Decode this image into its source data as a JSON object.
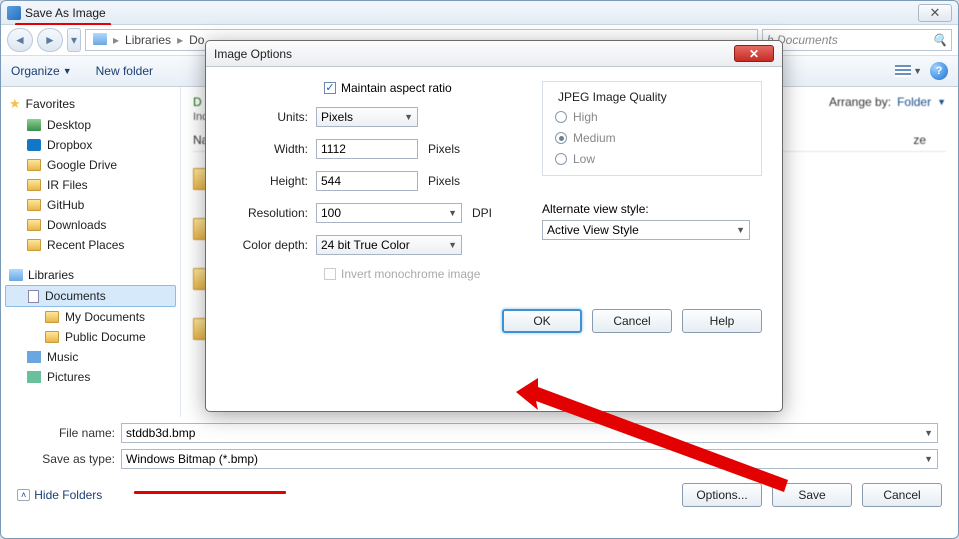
{
  "titlebar": {
    "title": "Save As Image"
  },
  "nav": {
    "breadcrumb_libraries": "Libraries",
    "breadcrumb_docs_prefix": "Do",
    "search_placeholder": "h Documents"
  },
  "toolbar": {
    "organize": "Organize",
    "newfolder": "New folder"
  },
  "sidebar": {
    "favorites": "Favorites",
    "items_fav": [
      {
        "label": "Desktop",
        "ic": "desktop"
      },
      {
        "label": "Dropbox",
        "ic": "drop"
      },
      {
        "label": "Google Drive",
        "ic": "folder"
      },
      {
        "label": "IR Files",
        "ic": "folder"
      },
      {
        "label": "GitHub",
        "ic": "folder"
      },
      {
        "label": "Downloads",
        "ic": "folder"
      },
      {
        "label": "Recent Places",
        "ic": "folder"
      }
    ],
    "libraries": "Libraries",
    "items_lib": [
      {
        "label": "Documents",
        "ic": "doc",
        "selected": true
      },
      {
        "label": "My Documents",
        "ic": "folder",
        "sub": true
      },
      {
        "label": "Public Docume",
        "ic": "folder",
        "sub": true
      },
      {
        "label": "Music",
        "ic": "music"
      },
      {
        "label": "Pictures",
        "ic": "pic"
      }
    ]
  },
  "content": {
    "title_prefix": "D",
    "subtitle_prefix": "Inc",
    "arrange_label": "Arrange by:",
    "arrange_value": "Folder",
    "name_col": "Na",
    "ze_col": "ze"
  },
  "fields": {
    "file_name_label": "File name:",
    "file_name_value": "stddb3d.bmp",
    "save_type_label": "Save as type:",
    "save_type_value": "Windows Bitmap (*.bmp)"
  },
  "footer": {
    "hide_folders": "Hide Folders",
    "options": "Options...",
    "save": "Save",
    "cancel": "Cancel"
  },
  "modal": {
    "title": "Image Options",
    "maintain_aspect": "Maintain aspect ratio",
    "units_label": "Units:",
    "units_value": "Pixels",
    "width_label": "Width:",
    "width_value": "1112",
    "width_unit": "Pixels",
    "height_label": "Height:",
    "height_value": "544",
    "height_unit": "Pixels",
    "resolution_label": "Resolution:",
    "resolution_value": "100",
    "resolution_unit": "DPI",
    "colordepth_label": "Color depth:",
    "colordepth_value": "24 bit True Color",
    "invert_label": "Invert monochrome image",
    "jpeg_legend": "JPEG Image Quality",
    "jpeg_high": "High",
    "jpeg_medium": "Medium",
    "jpeg_low": "Low",
    "alt_view_label": "Alternate view style:",
    "alt_view_value": "Active View Style",
    "ok": "OK",
    "cancel": "Cancel",
    "help": "Help"
  }
}
